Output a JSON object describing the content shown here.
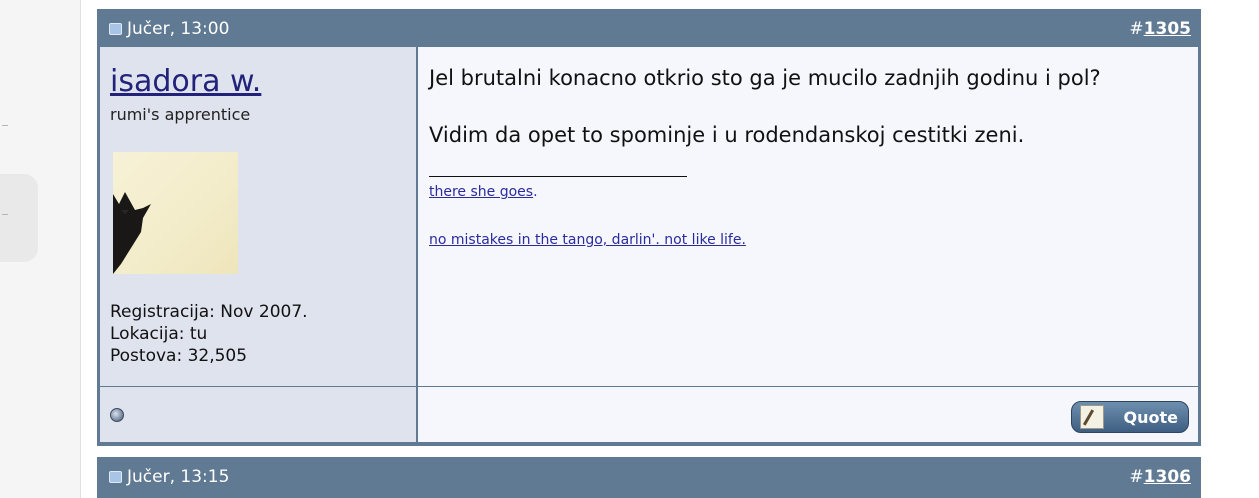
{
  "posts": [
    {
      "date": "Jučer, 13:00",
      "number_prefix": "#",
      "number": "1305",
      "user": {
        "name": "isadora w.",
        "title": "rumi's apprentice",
        "registration": "Registracija: Nov 2007.",
        "location": "Lokacija: tu",
        "posts": "Postova: 32,505",
        "status_icon": "offline-status-icon"
      },
      "message": {
        "line1": "Jel brutalni konacno otkrio sto ga je mucilo zadnjih godinu i pol?",
        "line2": "Vidim da opet to spominje i u rodendanskoj cestitki zeni.",
        "signature_link1": "there she goes",
        "signature_link1_suffix": ".",
        "signature_link2": "no mistakes in the tango, darlin'. not like life."
      },
      "quote_label": "Quote"
    },
    {
      "date": "Jučer, 13:15",
      "number_prefix": "#",
      "number": "1306"
    }
  ],
  "colors": {
    "header_bg": "#5f7a92",
    "user_cell_bg": "#dfe3ee",
    "message_cell_bg": "#f5f7fc",
    "link": "#2b2b9e",
    "username": "#22227a"
  }
}
